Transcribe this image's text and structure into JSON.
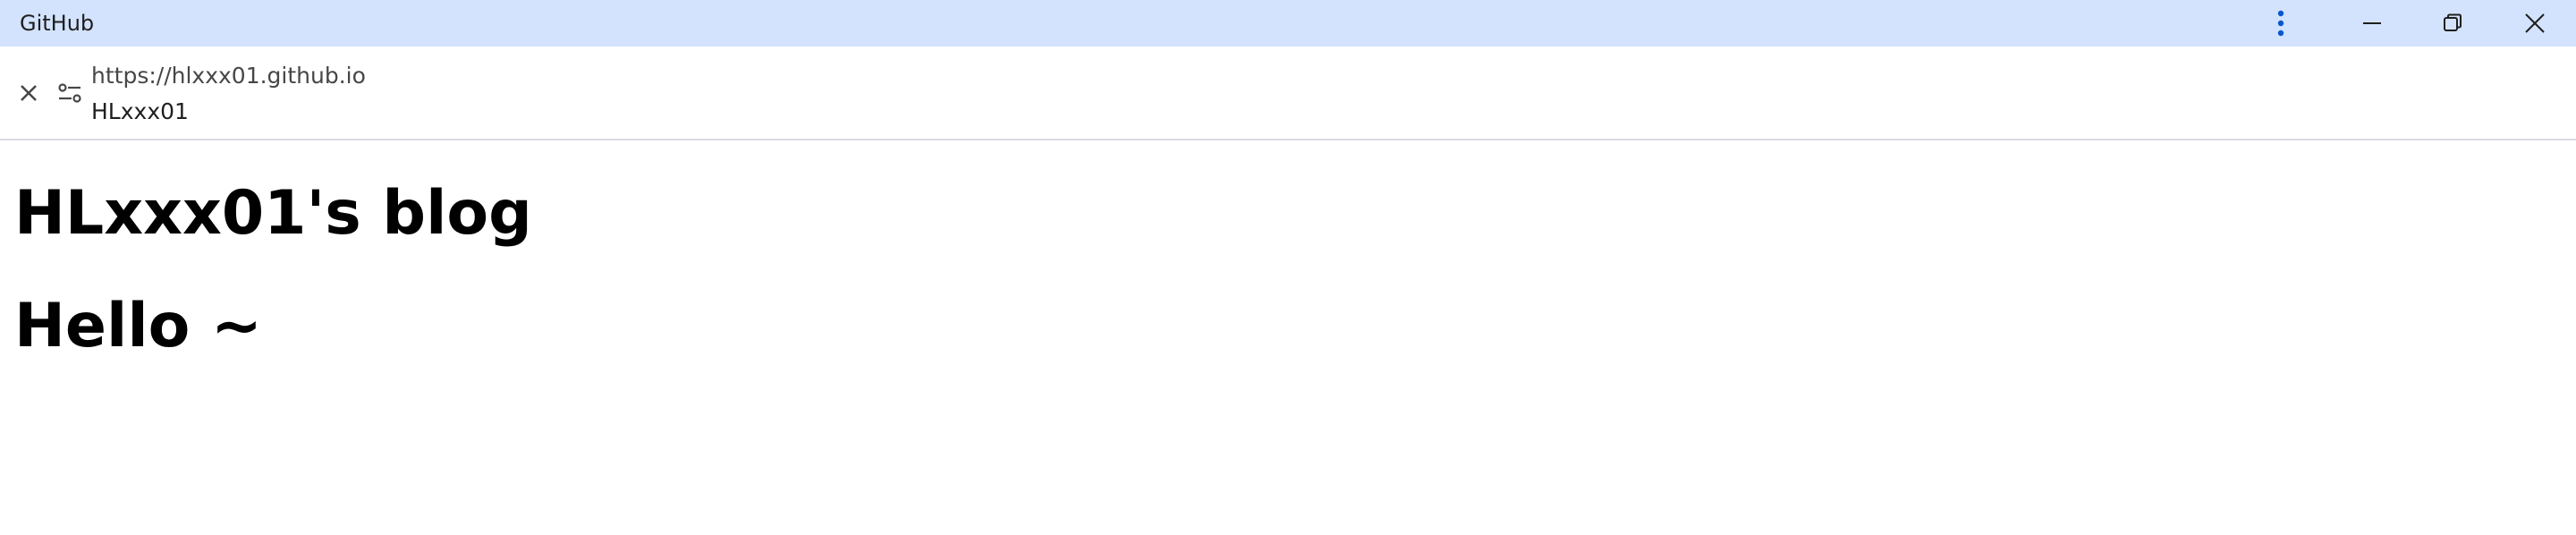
{
  "window": {
    "title": "GitHub"
  },
  "address_bar": {
    "url": "https://hlxxx01.github.io",
    "site_name": "HLxxx01"
  },
  "page": {
    "heading": "HLxxx01's blog",
    "subheading": "Hello ~"
  },
  "colors": {
    "titlebar_bg": "#d3e3fd",
    "kebab_accent": "#0b57d0",
    "text_primary": "#1f1f1f"
  },
  "icons": {
    "menu": "more-vert-icon",
    "minimize": "minimize-icon",
    "restore": "restore-icon",
    "close": "close-icon",
    "close_tab": "close-x-icon",
    "site_settings": "tune-icon"
  }
}
